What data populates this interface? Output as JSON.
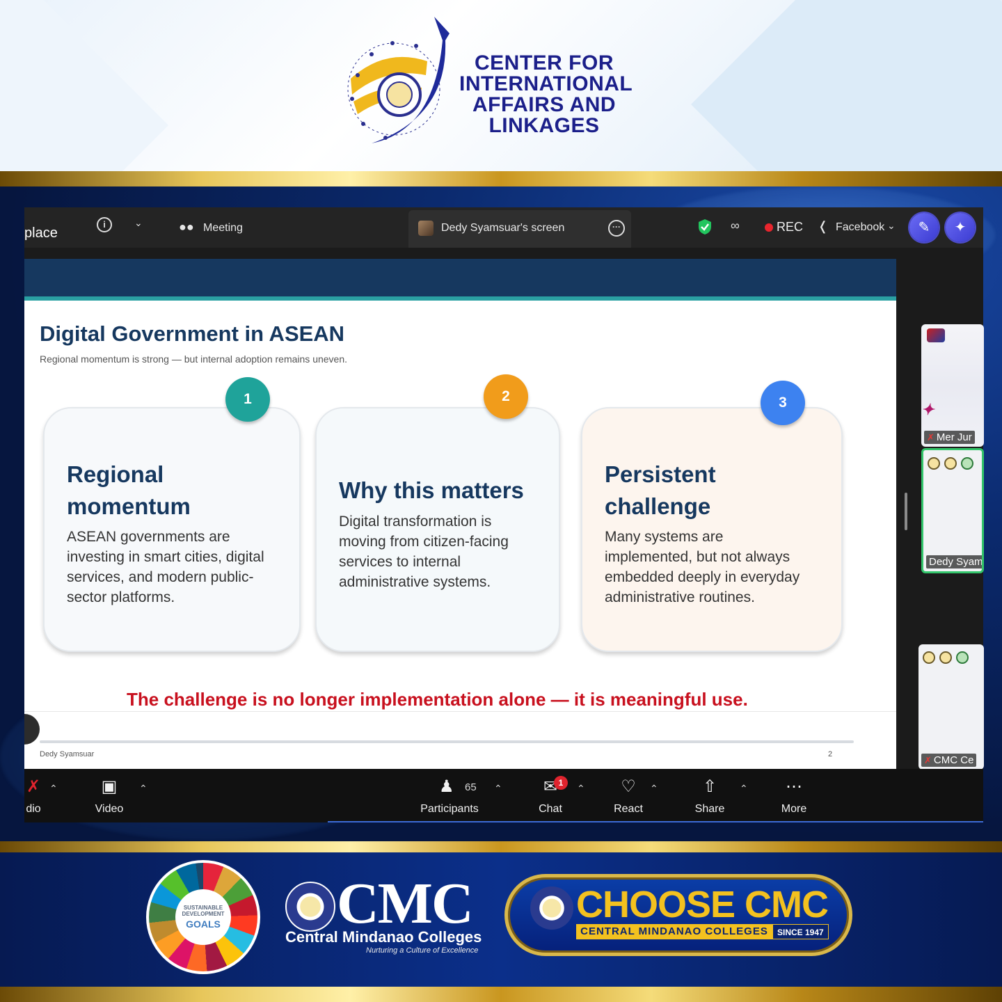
{
  "header": {
    "title_lines": [
      "CENTER FOR",
      "INTERNATIONAL",
      "AFFAIRS AND",
      "LINKAGES"
    ]
  },
  "zoom": {
    "top_bar": {
      "app_label": "place",
      "meeting_label": "Meeting",
      "screen_label": "Dedy Syamsuar's screen",
      "rec_label": "REC",
      "stream_label": "Facebook"
    },
    "toolbar": {
      "audio_label": "dio",
      "video_label": "Video",
      "participants_label": "Participants",
      "participants_count": "65",
      "chat_label": "Chat",
      "chat_badge": "1",
      "react_label": "React",
      "share_label": "Share",
      "more_label": "More"
    },
    "participants": [
      {
        "name": "Mer Jur"
      },
      {
        "name": "Dedy Syam"
      },
      {
        "name": "CMC Ce"
      }
    ]
  },
  "slide": {
    "title": "Digital Government in ASEAN",
    "subtitle": "Regional momentum is strong — but internal adoption remains uneven.",
    "cards": [
      {
        "number": "1",
        "heading_line1": "Regional",
        "heading_line2": "momentum",
        "body_lines": [
          "ASEAN governments are",
          "investing in smart cities, digital",
          "services, and modern public-",
          "sector platforms."
        ]
      },
      {
        "number": "2",
        "heading_line1": "Why this matters",
        "heading_line2": "",
        "body_lines": [
          "Digital transformation is",
          "moving from citizen-facing",
          "services to internal",
          "administrative systems."
        ]
      },
      {
        "number": "3",
        "heading_line1": "Persistent",
        "heading_line2": "challenge",
        "body_lines": [
          "Many systems are",
          "implemented, but not always",
          "embedded deeply in everyday",
          "administrative routines."
        ]
      }
    ],
    "callout": "The challenge is no longer implementation alone — it is meaningful use.",
    "footer_name": "Dedy Syamsuar",
    "page_number": "2"
  },
  "footer": {
    "sdg_text_line1": "SUSTAINABLE",
    "sdg_text_line2": "DEVELOPMENT",
    "sdg_goals": "GOALS",
    "cmc_big": "CMC",
    "cmc_name": "Central Mindanao Colleges",
    "cmc_tagline": "Nurturing a Culture of Excellence",
    "choose_text": "CHOOSE CMC",
    "choose_sub": "CENTRAL MINDANAO COLLEGES",
    "since": "SINCE 1947"
  },
  "colors": {
    "brand_navy": "#16385f",
    "accent_teal": "#2aa0a2",
    "callout_red": "#c8101e",
    "badge1": "#1fa39a",
    "badge2": "#f19c1b",
    "badge3": "#3d82f0",
    "gold": "#f3c11f"
  }
}
